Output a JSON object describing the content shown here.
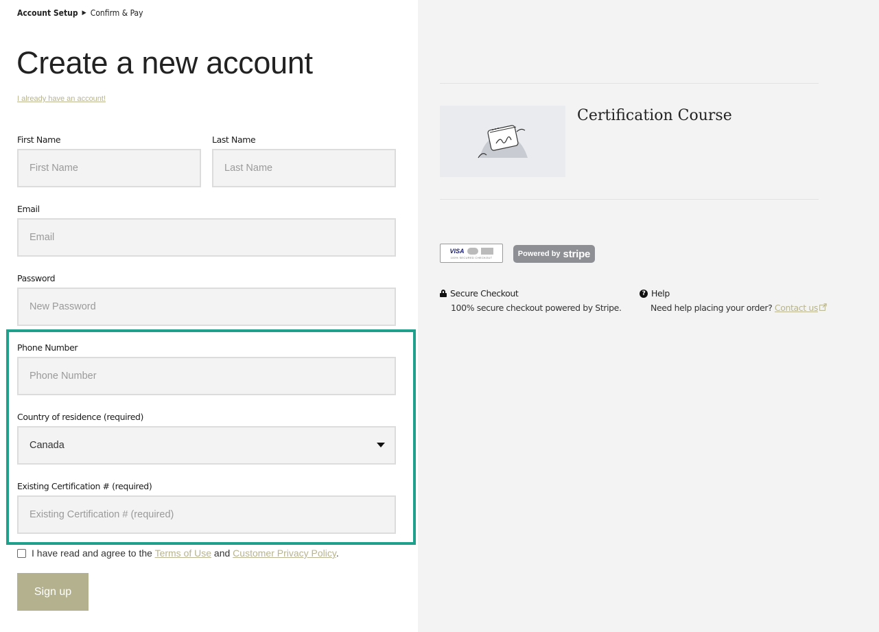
{
  "breadcrumb": {
    "step1": "Account Setup",
    "separator": "▶",
    "step2": "Confirm & Pay"
  },
  "title": "Create a new account",
  "login_link": "I already have an account!",
  "form": {
    "first_name": {
      "label": "First Name",
      "placeholder": "First Name"
    },
    "last_name": {
      "label": "Last Name",
      "placeholder": "Last Name"
    },
    "email": {
      "label": "Email",
      "placeholder": "Email"
    },
    "password": {
      "label": "Password",
      "placeholder": "New Password"
    },
    "phone": {
      "label": "Phone Number",
      "placeholder": "Phone Number"
    },
    "country": {
      "label": "Country of residence (required)",
      "value": "Canada"
    },
    "certification": {
      "label": "Existing Certification # (required)",
      "placeholder": "Existing Certification # (required)"
    }
  },
  "terms": {
    "prefix": "I have read and agree to the",
    "terms_link": "Terms of Use",
    "and": "and",
    "privacy_link": "Customer Privacy Policy",
    "suffix": "."
  },
  "signup_label": "Sign up",
  "course": {
    "title": "Certification Course"
  },
  "badges": {
    "visa": "VISA",
    "secured": "100% SECURED CHECKOUT",
    "powered_by": "Powered by",
    "stripe": "stripe"
  },
  "secure_checkout": {
    "title": "Secure Checkout",
    "body": "100% secure checkout powered by Stripe."
  },
  "help": {
    "title": "Help",
    "body": "Need help placing your order?",
    "link": "Contact us"
  },
  "colors": {
    "accent": "#b7b48f",
    "button": "#b4b28e",
    "highlight": "#1fa08c",
    "panel": "#f3f3f3"
  }
}
